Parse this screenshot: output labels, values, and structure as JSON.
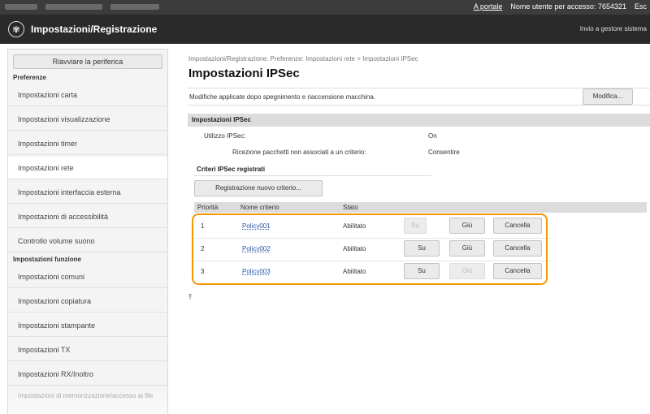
{
  "topbar": {
    "portal_link": "A portale",
    "user_label": "Nome utente per accesso:",
    "user_value": "7654321",
    "logout_link": "Esc"
  },
  "header": {
    "logo_icon": "canon-settings-icon",
    "title": "Impostazioni/Registrazione",
    "send_link": "Invio a gestore sistema"
  },
  "sidebar": {
    "restart_label": "Riavviare la periferica",
    "section_preferences": "Preferenze",
    "items_preferences": [
      "Impostazioni carta",
      "Impostazioni visualizzazione",
      "Impostazioni timer",
      "Impostazioni rete",
      "Impostazioni interfaccia esterna",
      "Impostazioni di accessibilità",
      "Controllo volume suono"
    ],
    "section_functions": "Impostazioni funzione",
    "items_functions": [
      "Impostazioni comuni",
      "Impostazioni copiatura",
      "Impostazioni stampante",
      "Impostazioni TX",
      "Impostazioni RX/Inoltro"
    ],
    "faded_item": "Impostazioni di memorizzazione/accesso ai file"
  },
  "main": {
    "breadcrumb": "Impostazioni/Registrazione: Preferenze: Impostazioni rete > Impostazioni IPSec",
    "title": "Impostazioni IPSec",
    "notice": "Modifiche applicate dopo spegnimento e riaccensione macchina.",
    "edit_button": "Modifica...",
    "section_title": "Impostazioni IPSec",
    "use_label": "Utilizzo IPSec:",
    "use_value": "On",
    "receive_label": "Ricezione pacchetti non associati a un criterio:",
    "receive_value": "Consentire",
    "registered_title": "Criteri IPSec registrati",
    "register_button": "Registrazione nuovo criterio...",
    "columns": [
      "Priorità",
      "Nome criterio",
      "Stato"
    ],
    "rows": [
      {
        "priority": "1",
        "name": "Policy001",
        "status": "Abilitato",
        "up": "Su",
        "down": "Giù",
        "delete": "Cancella"
      },
      {
        "priority": "2",
        "name": "Policy002",
        "status": "Abilitato",
        "up": "Su",
        "down": "Giù",
        "delete": "Cancella"
      },
      {
        "priority": "3",
        "name": "Policy003",
        "status": "Abilitato",
        "up": "Su",
        "down": "Giù",
        "delete": "Cancella"
      }
    ],
    "top_icon": "scroll-to-top-icon",
    "highlight_color": "#f39800"
  }
}
